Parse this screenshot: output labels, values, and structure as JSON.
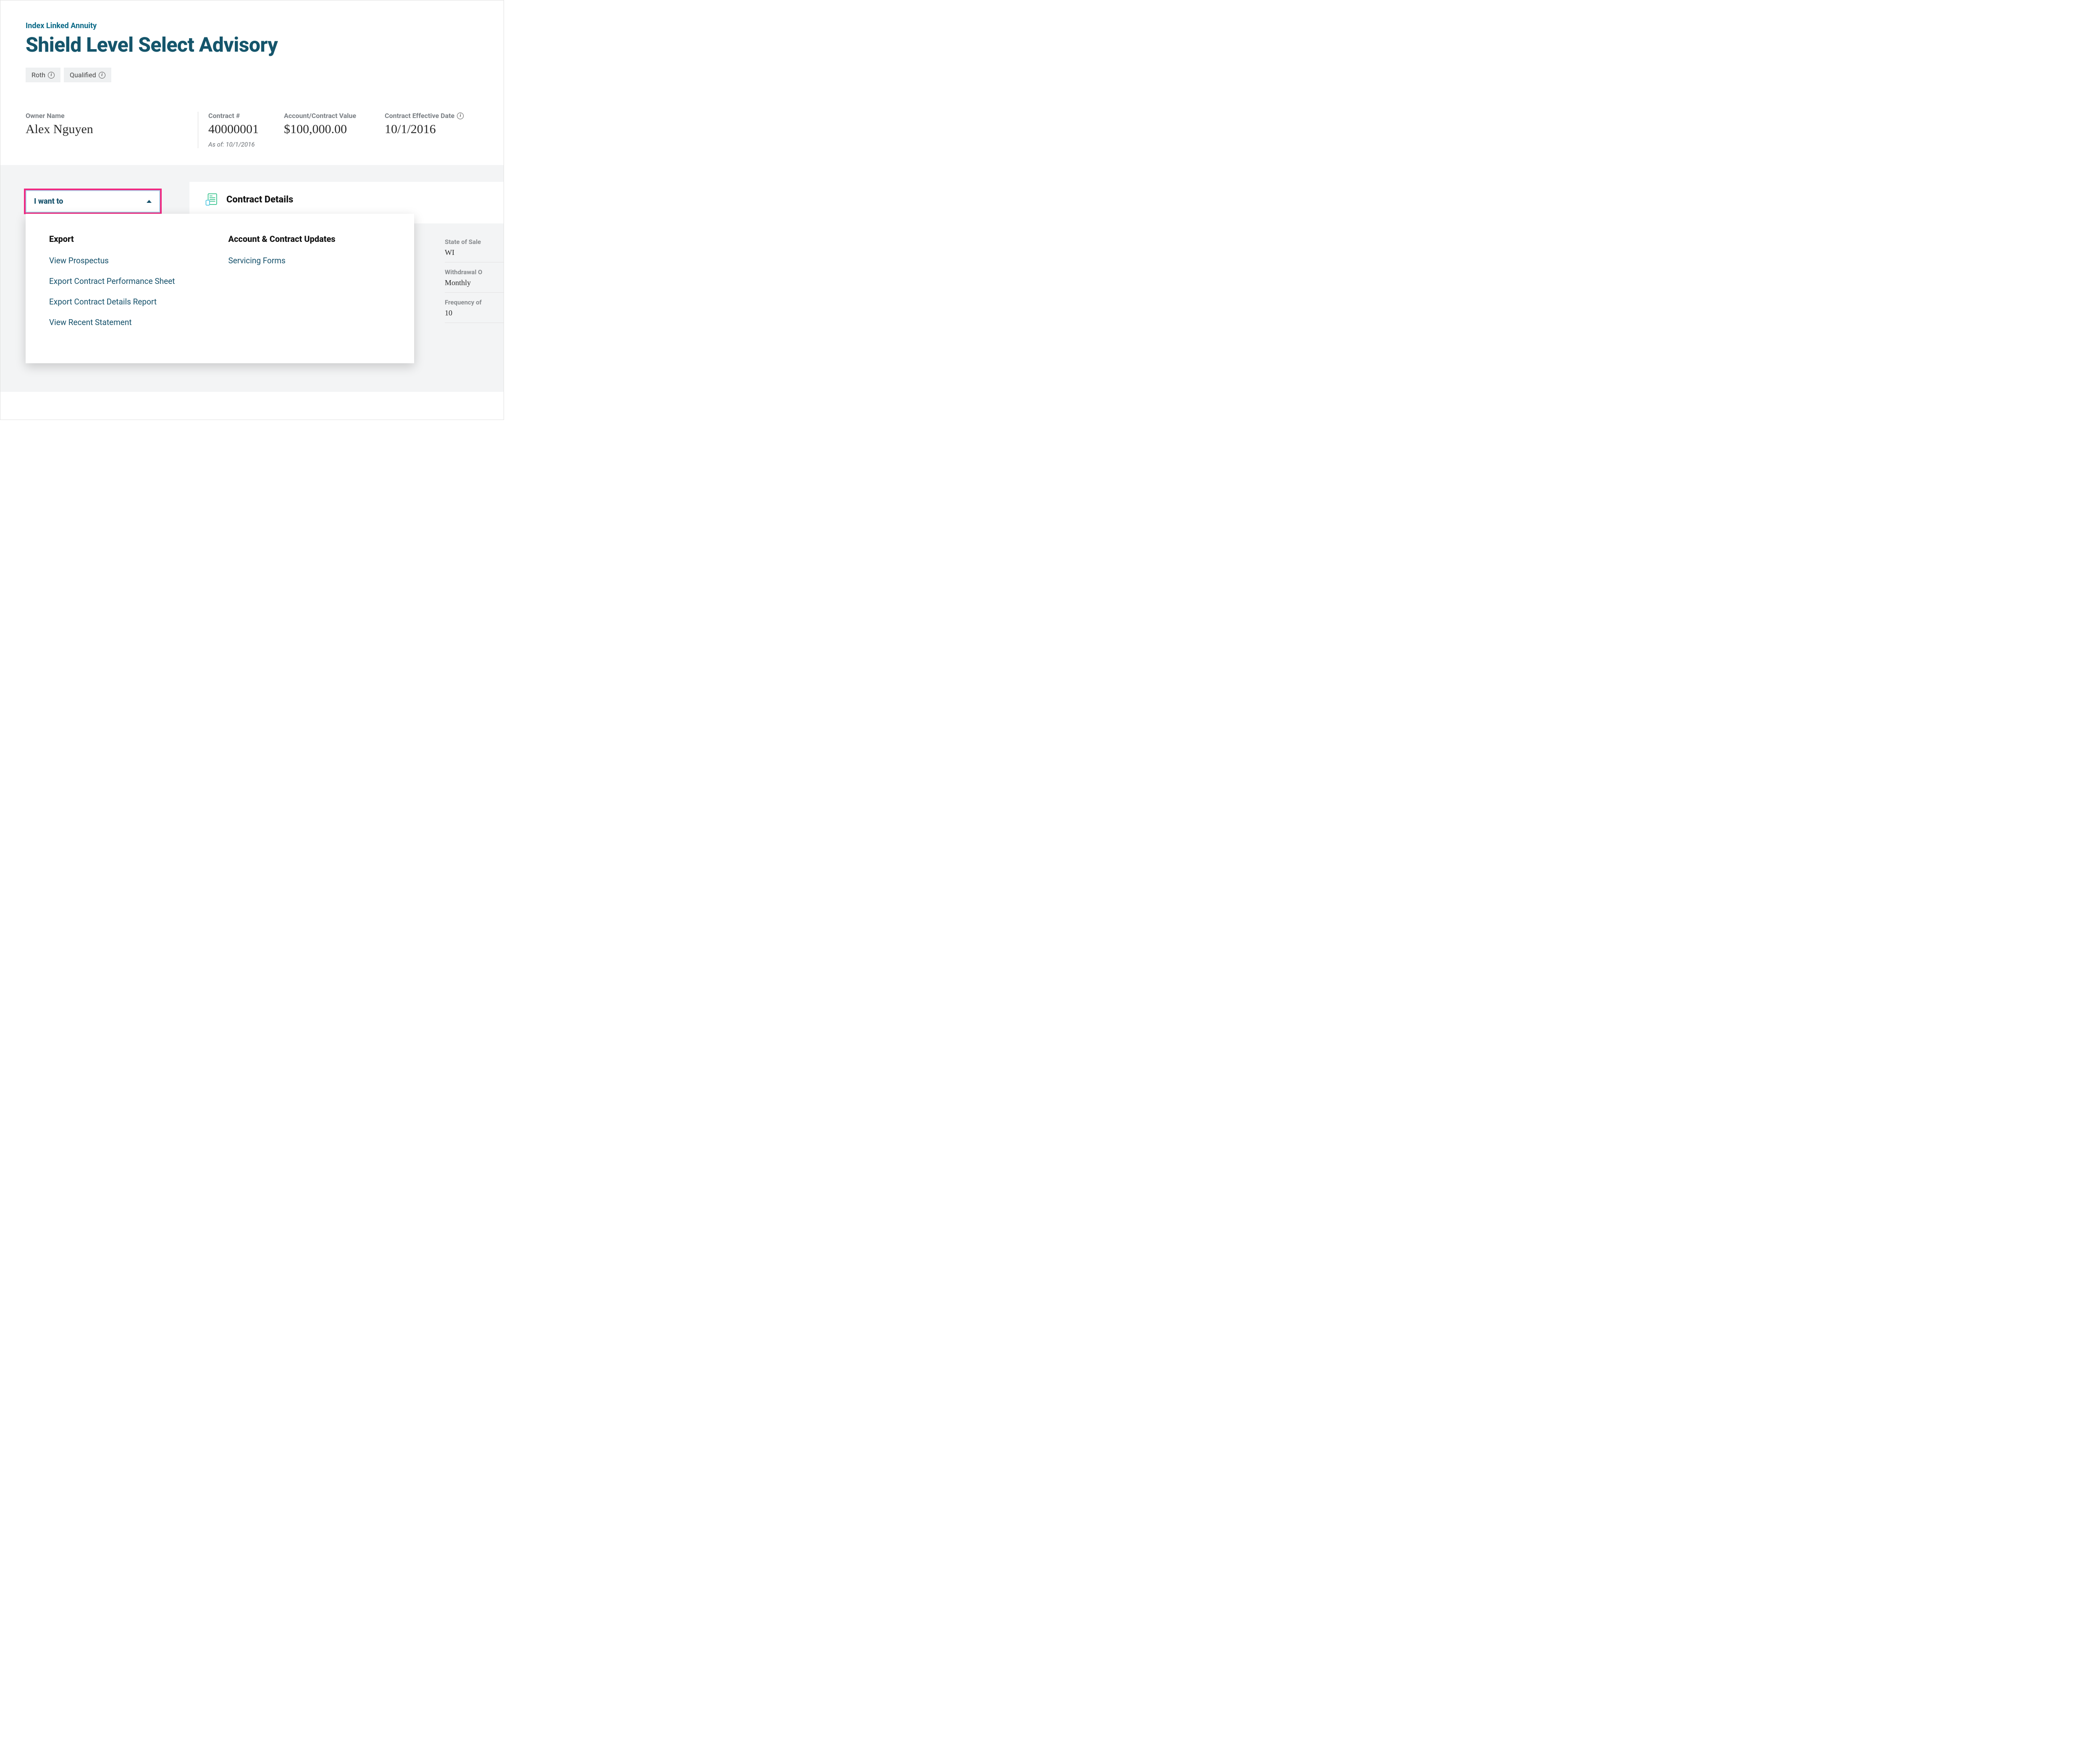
{
  "header": {
    "eyebrow": "Index Linked Annuity",
    "title": "Shield Level Select Advisory",
    "tags": [
      "Roth",
      "Qualified"
    ]
  },
  "summary": {
    "owner_label": "Owner Name",
    "owner_value": "Alex Nguyen",
    "contract_label": "Contract #",
    "contract_value": "40000001",
    "contract_asof": "As of: 10/1/2016",
    "value_label": "Account/Contract Value",
    "value_value": "$100,000.00",
    "date_label": "Contract Effective Date",
    "date_value": "10/1/2016"
  },
  "dropdown": {
    "label": "I want to",
    "export_heading": "Export",
    "export_items": [
      "View Prospectus",
      "Export Contract Performance Sheet",
      "Export Contract Details Report",
      "View Recent Statement"
    ],
    "updates_heading": "Account & Contract Updates",
    "updates_items": [
      "Servicing Forms"
    ]
  },
  "details": {
    "title": "Contract Details",
    "fields": [
      {
        "label": "State of Sale",
        "value": "WI"
      },
      {
        "label": "Withdrawal O",
        "value": "Monthly"
      },
      {
        "label": "Frequency of",
        "value": "10"
      }
    ]
  }
}
